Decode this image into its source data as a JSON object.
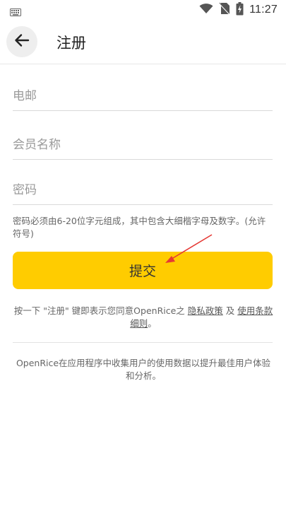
{
  "status_bar": {
    "time": "11:27",
    "icons": [
      "keyboard-icon",
      "wifi-icon",
      "no-sim-icon",
      "battery-charging-icon"
    ]
  },
  "app_bar": {
    "back_icon": "arrow-left-icon",
    "title": "注册"
  },
  "form": {
    "email": {
      "placeholder": "电邮",
      "value": ""
    },
    "member_name": {
      "placeholder": "会员名称",
      "value": ""
    },
    "password": {
      "placeholder": "密码",
      "value": ""
    },
    "password_hint": "密码必须由6-20位字元组成，其中包含大细楷字母及数字。(允许符号)"
  },
  "submit": {
    "label": "提交",
    "color": "#ffcc00"
  },
  "annotation": {
    "arrow_color": "#e53935"
  },
  "terms": {
    "prefix": "按一下 \"注册\" 键即表示您同意OpenRice之 ",
    "privacy_link": "隐私政策",
    "and": " 及 ",
    "terms_link": "使用条款细则",
    "suffix": "。"
  },
  "notice": "OpenRice在应用程序中收集用户的使用数据以提升最佳用户体验和分析。"
}
